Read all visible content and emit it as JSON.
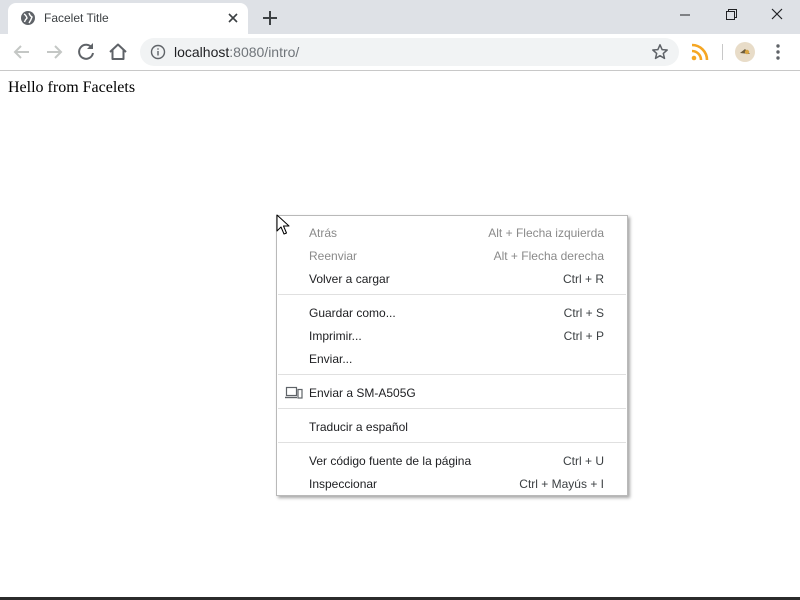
{
  "tab": {
    "title": "Facelet Title",
    "favicon": "globe-icon",
    "close_icon": "close-icon"
  },
  "new_tab_icon": "plus-icon",
  "window_controls": [
    "minimize-icon",
    "restore-icon",
    "close-icon"
  ],
  "toolbar": {
    "back_icon": "arrow-back-icon",
    "forward_icon": "arrow-forward-icon",
    "reload_icon": "reload-icon",
    "home_icon": "home-icon"
  },
  "omnibox": {
    "info_icon": "info-icon",
    "url_host": "localhost",
    "url_rest": ":8080/intro/",
    "bookmark_icon": "star-icon"
  },
  "extensions": [
    "rss-icon",
    "profile-avatar-icon"
  ],
  "menu_icon": "kebab-menu-icon",
  "page": {
    "text": "Hello from Facelets"
  },
  "context_menu": {
    "back": {
      "label": "Atrás",
      "shortcut": "Alt + Flecha izquierda",
      "enabled": false
    },
    "forward": {
      "label": "Reenviar",
      "shortcut": "Alt + Flecha derecha",
      "enabled": false
    },
    "reload": {
      "label": "Volver a cargar",
      "shortcut": "Ctrl + R",
      "enabled": true
    },
    "save_as": {
      "label": "Guardar como...",
      "shortcut": "Ctrl + S",
      "enabled": true
    },
    "print": {
      "label": "Imprimir...",
      "shortcut": "Ctrl + P",
      "enabled": true
    },
    "cast": {
      "label": "Enviar...",
      "enabled": true
    },
    "send_to_device": {
      "label": "Enviar a SM-A505G",
      "icon": "devices-icon",
      "enabled": true
    },
    "translate": {
      "label": "Traducir a español",
      "enabled": true
    },
    "view_source": {
      "label": "Ver código fuente de la página",
      "shortcut": "Ctrl + U",
      "enabled": true
    },
    "inspect": {
      "label": "Inspeccionar",
      "shortcut": "Ctrl + Mayús + I",
      "enabled": true
    }
  },
  "colors": {
    "tabstrip_bg": "#dee1e6",
    "omnibox_bg": "#f1f3f4",
    "disabled_text": "#8a8a8a",
    "rss_orange": "#f5a623"
  }
}
